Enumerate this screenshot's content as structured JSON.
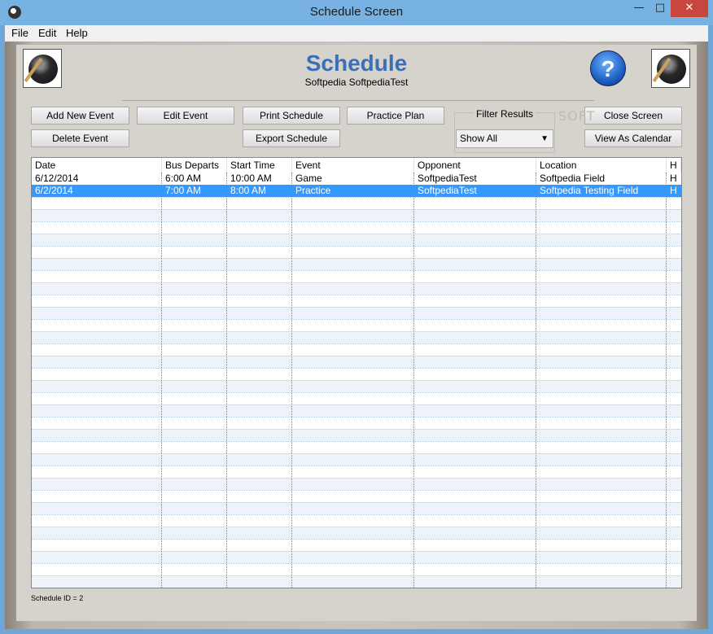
{
  "window": {
    "title": "Schedule Screen",
    "minimize": "—",
    "maximize": "□",
    "close": "✕"
  },
  "menu": {
    "file": "File",
    "edit": "Edit",
    "help": "Help"
  },
  "header": {
    "title": "Schedule",
    "subtitle": "Softpedia SoftpediaTest",
    "help_icon_label": "?"
  },
  "buttons": {
    "add_new_event": "Add New Event",
    "edit_event": "Edit Event",
    "print_schedule": "Print Schedule",
    "practice_plan": "Practice Plan",
    "close_screen": "Close Screen",
    "delete_event": "Delete Event",
    "export_schedule": "Export Schedule",
    "view_as_calendar": "View As Calendar"
  },
  "filter": {
    "label": "Filter Results",
    "selected": "Show All"
  },
  "watermark": "SOFT",
  "table": {
    "columns": [
      "Date",
      "Bus Departs",
      "Start Time",
      "Event",
      "Opponent",
      "Location",
      "H"
    ],
    "rows": [
      [
        "6/12/2014",
        "6:00 AM",
        "10:00 AM",
        "Game",
        "SoftpediaTest",
        "Softpedia Field",
        "H"
      ],
      [
        "6/2/2014",
        "7:00 AM",
        "8:00 AM",
        "Practice",
        "SoftpediaTest",
        "Softpedia Testing Field",
        "H"
      ]
    ],
    "selected_row": 1
  },
  "status": {
    "text": "Schedule ID = 2"
  },
  "icons": {
    "app": "baseball-app-icon",
    "logo": "baseball-player-logo",
    "help": "help-icon"
  },
  "colors": {
    "title_blue": "#3d6fb6",
    "selection": "#3399ff",
    "titlebar": "#78b2e2",
    "close_red": "#c7463d"
  }
}
